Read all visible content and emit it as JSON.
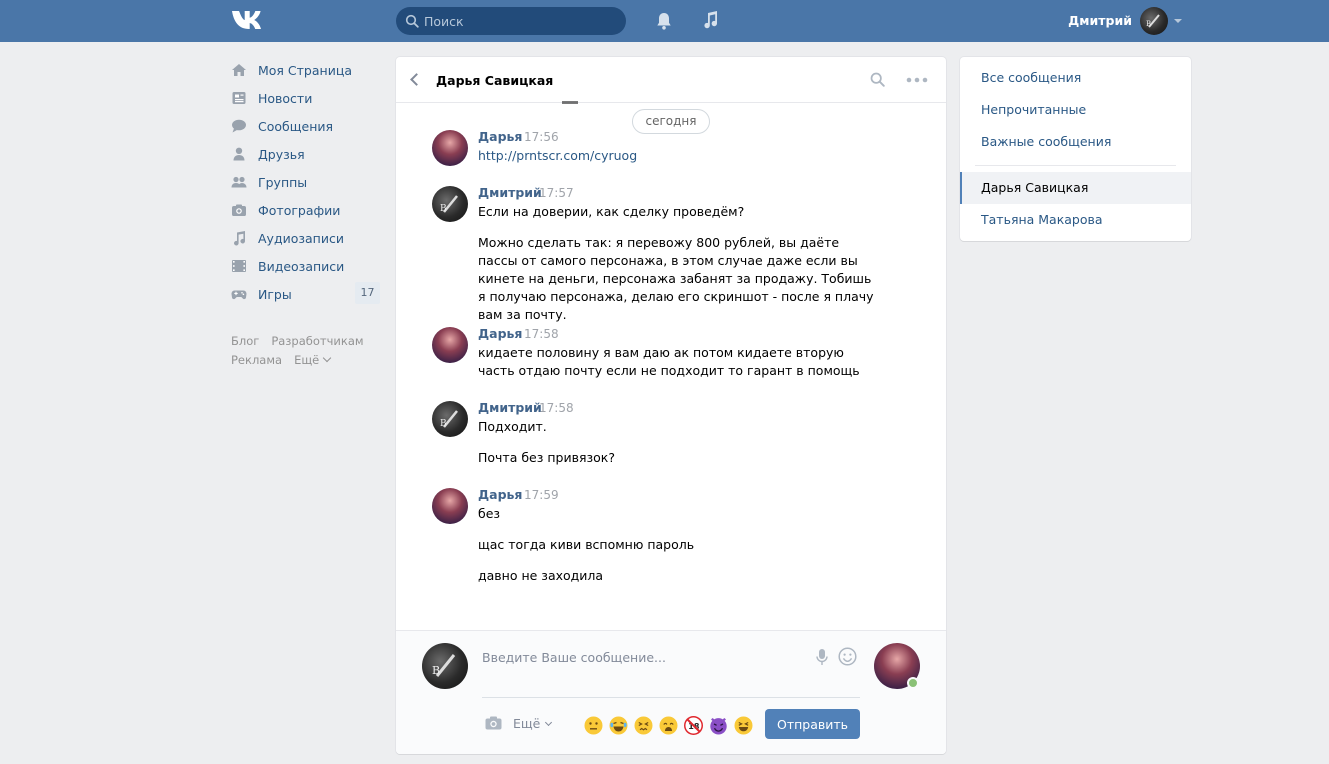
{
  "header": {
    "logo": "VK",
    "search_placeholder": "Поиск",
    "username": "Дмитрий"
  },
  "sidebar": {
    "items": [
      {
        "label": "Моя Страница",
        "icon": "home-icon"
      },
      {
        "label": "Новости",
        "icon": "news-icon"
      },
      {
        "label": "Сообщения",
        "icon": "messages-icon"
      },
      {
        "label": "Друзья",
        "icon": "friends-icon"
      },
      {
        "label": "Группы",
        "icon": "groups-icon"
      },
      {
        "label": "Фотографии",
        "icon": "camera-icon"
      },
      {
        "label": "Аудиозаписи",
        "icon": "music-icon"
      },
      {
        "label": "Видеозаписи",
        "icon": "video-icon"
      },
      {
        "label": "Игры",
        "icon": "gamepad-icon",
        "badge": "17"
      }
    ],
    "footer": {
      "blog": "Блог",
      "developers": "Разработчикам",
      "ads": "Реклама",
      "more": "Ещё"
    }
  },
  "chat": {
    "title": "Дарья Савицкая",
    "date_divider": "сегодня",
    "messages": [
      {
        "author": "Дарья",
        "time": "17:56",
        "lines": [
          "http://prntscr.com/cyruog"
        ],
        "link": true
      },
      {
        "author": "Дмитрий",
        "time": "17:57",
        "lines": [
          "Если на доверии, как сделку проведём?",
          "Можно сделать так: я перевожу 800 рублей, вы даёте пассы от самого персонажа, в этом случае даже если вы кинете на деньги, персонажа забанят за продажу. Тобишь я получаю персонажа, делаю его скриншот - после я плачу вам за почту."
        ]
      },
      {
        "author": "Дарья",
        "time": "17:58",
        "lines": [
          "кидаете половину я вам даю ак потом кидаете вторую часть отдаю почту если не подходит то гарант в помощь"
        ]
      },
      {
        "author": "Дмитрий",
        "time": "17:58",
        "lines": [
          "Подходит.",
          "Почта без привязок?"
        ]
      },
      {
        "author": "Дарья",
        "time": "17:59",
        "lines": [
          "без",
          "щас тогда киви вспомню пароль",
          "давно не заходила"
        ]
      }
    ],
    "composer": {
      "placeholder": "Введите Ваше сообщение...",
      "more_label": "Ещё",
      "send_label": "Отправить",
      "emojis": [
        "neutral-face",
        "laughing-tears",
        "persevering-face",
        "weary-face",
        "no-under-18",
        "smiling-imp",
        "squinting-grin"
      ]
    }
  },
  "right_panel": {
    "filters": [
      "Все сообщения",
      "Непрочитанные",
      "Важные сообщения"
    ],
    "dialogs": [
      {
        "name": "Дарья Савицкая",
        "active": true
      },
      {
        "name": "Татьяна Макарова",
        "active": false
      }
    ]
  },
  "colors": {
    "header_bg": "#4a76a8",
    "link": "#2a5885",
    "author": "#42648b",
    "send_button": "#5181b8",
    "online": "#8ac176"
  }
}
